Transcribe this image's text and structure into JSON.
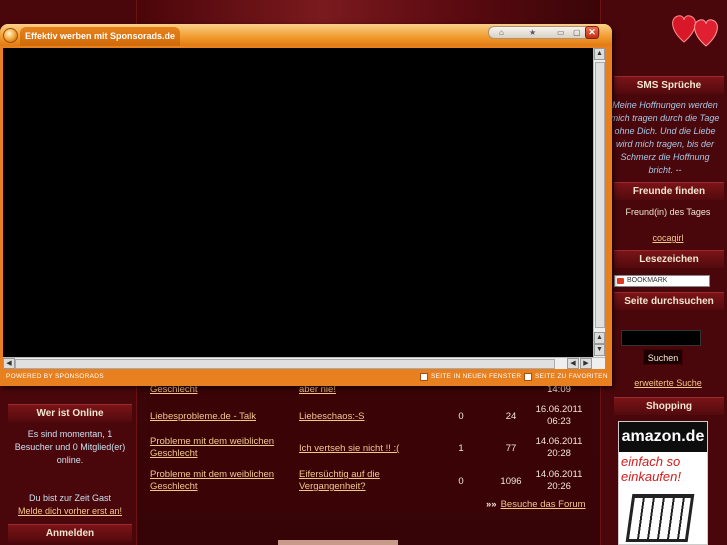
{
  "popup": {
    "tab_title": "Effektiv werben mit Sponsorads.de",
    "close_glyph": "✕",
    "controls": [
      "⌂",
      "★",
      "▭",
      "▢"
    ],
    "powered_by": "POWERED BY SPONSORADS",
    "new_window": "SEITE IN NEUEN FENSTER",
    "favorites": "SEITE ZU FAVORITEN"
  },
  "left": {
    "online_title": "Wer ist Online",
    "online_text": "Es sind momentan, 1 Besucher und 0 Mitglied(er) online.",
    "guest_text": "Du bist zur Zeit Gast",
    "login_link": "Melde dich vorher erst an!",
    "login_title": "Anmelden"
  },
  "right": {
    "sms_title": "SMS Sprüche",
    "sms_quote": "Meine Hoffnungen werden mich tragen durch die Tage ohne Dich. Und die Liebe wird mich tragen, bis der Schmerz die Hoffnung bricht. --",
    "friends_title": "Freunde finden",
    "friend_of_day": "Freund(in) des Tages",
    "friend_name": "cocagirl",
    "bookmarks_title": "Lesezeichen",
    "bookmark_label": "BOOKMARK",
    "search_title": "Seite durchsuchen",
    "search_button": "Suchen",
    "advanced_search": "erweiterte Suche",
    "shopping_title": "Shopping",
    "amazon_logo": "amazon.de",
    "amazon_slogan": "einfach so einkaufen!"
  },
  "forum": {
    "rows": [
      {
        "board": "Geschlecht",
        "topic": "aber nie!",
        "replies": "",
        "views": "",
        "date": "14:09"
      },
      {
        "board": "Liebesprobleme.de - Talk",
        "topic": "Liebeschaos:-S",
        "replies": "0",
        "views": "24",
        "date": "16.06.2011 06:23"
      },
      {
        "board": "Probleme mit dem weiblichen Geschlecht",
        "topic": "Ich vertseh sie nicht !! :(",
        "replies": "1",
        "views": "77",
        "date": "14.06.2011 20:28"
      },
      {
        "board": "Probleme mit dem weiblichen Geschlecht",
        "topic": "Eifersüchtig auf die Vergangenheit?",
        "replies": "0",
        "views": "1096",
        "date": "14.06.2011 20:26"
      }
    ],
    "footer_arrows": "»»",
    "footer_link": "Besuche das Forum"
  }
}
